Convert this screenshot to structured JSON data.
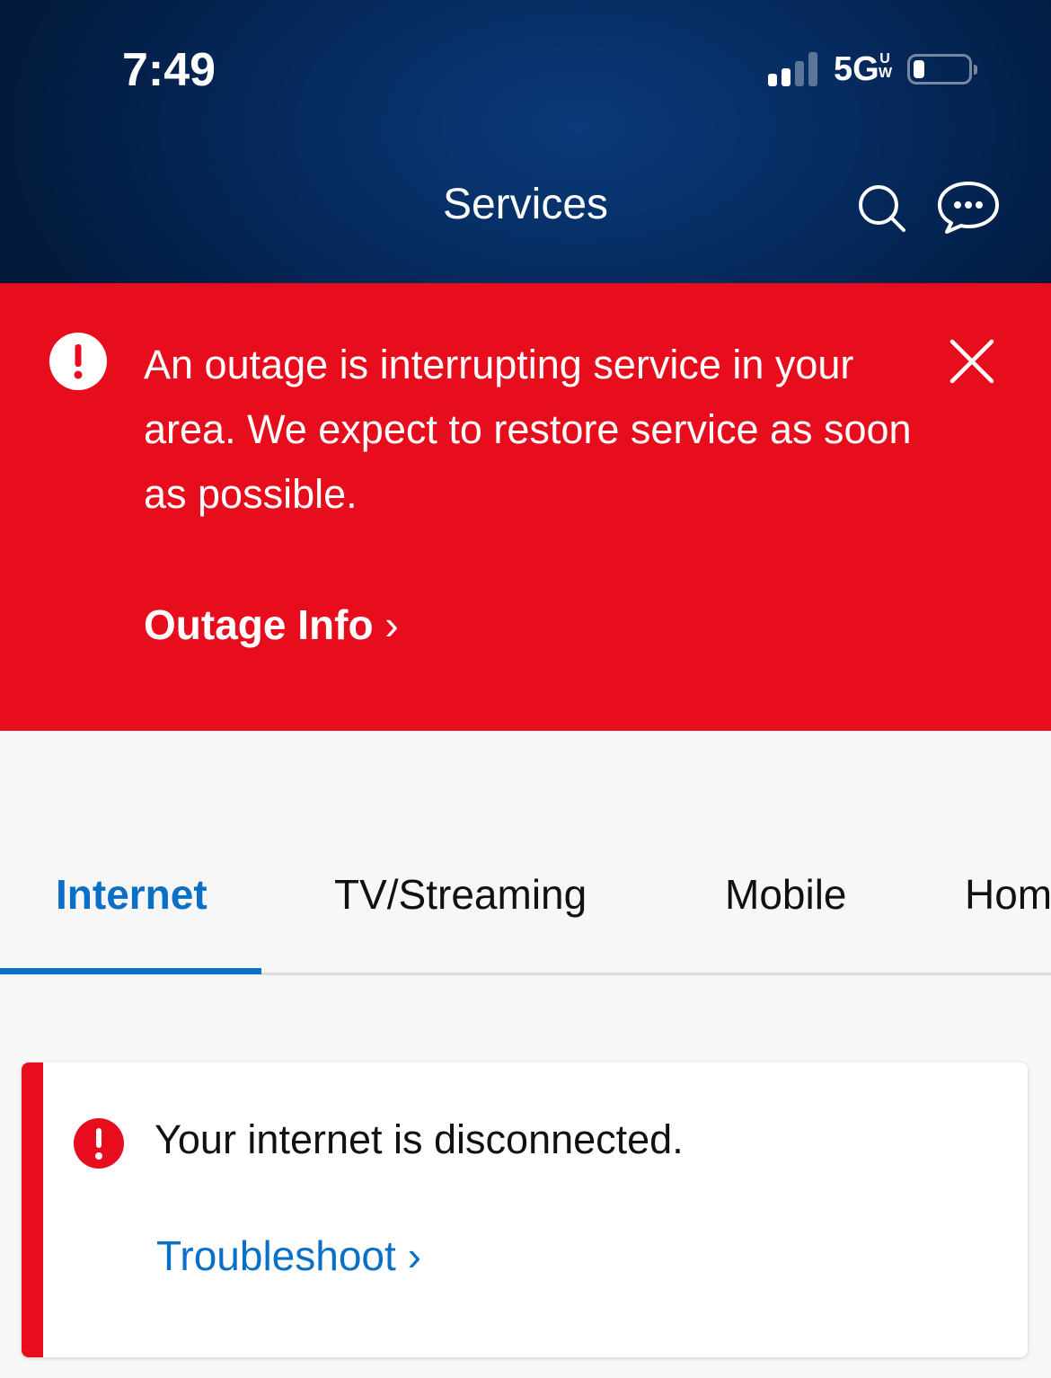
{
  "status_bar": {
    "time": "7:49",
    "network": "5G",
    "network_superscript_top": "U",
    "network_superscript_bottom": "W",
    "signal_bars_active": 2,
    "signal_bars_total": 4,
    "battery_level_percent": 15
  },
  "header": {
    "title": "Services",
    "icons": [
      "search-icon",
      "chat-icon"
    ]
  },
  "outage_alert": {
    "icon": "exclamation-circle-icon",
    "message": "An outage is interrupting service in your area. We expect to restore service as soon as possible.",
    "link_label": "Outage Info",
    "link_chevron": "›",
    "close_icon": "close-icon",
    "color": "#e80d1d"
  },
  "tabs": {
    "items": [
      {
        "label": "Internet",
        "active": true
      },
      {
        "label": "TV/Streaming",
        "active": false
      },
      {
        "label": "Mobile",
        "active": false
      },
      {
        "label": "Home",
        "active": false
      }
    ],
    "accent": "#0a6fc6"
  },
  "status_card": {
    "icon": "exclamation-circle-icon",
    "message": "Your internet is disconnected.",
    "link_label": "Troubleshoot",
    "link_chevron": "›"
  }
}
